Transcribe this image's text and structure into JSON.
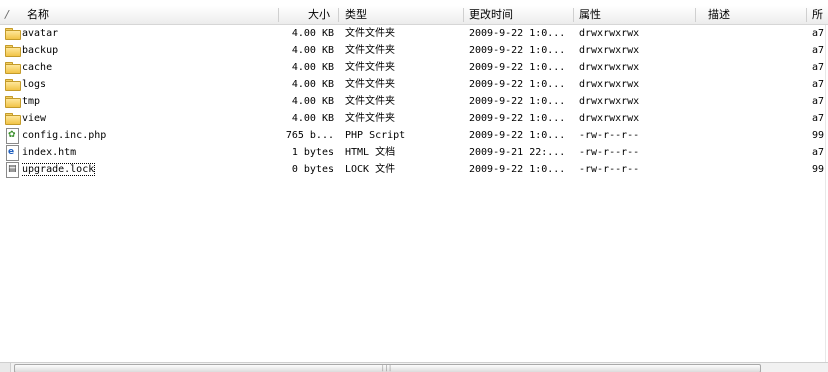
{
  "header": {
    "sort_indicator": "/",
    "columns": {
      "name": "名称",
      "size": "大小",
      "type": "类型",
      "modified": "更改时间",
      "permissions": "属性",
      "description": "描述",
      "owner": "所"
    }
  },
  "files": [
    {
      "name": "avatar",
      "size": "4.00 KB",
      "type": "文件文件夹",
      "modified": "2009-9-22 1:0...",
      "permissions": "drwxrwxrwx",
      "owner": "a7",
      "icon": "folder-icon"
    },
    {
      "name": "backup",
      "size": "4.00 KB",
      "type": "文件文件夹",
      "modified": "2009-9-22 1:0...",
      "permissions": "drwxrwxrwx",
      "owner": "a7",
      "icon": "folder-icon"
    },
    {
      "name": "cache",
      "size": "4.00 KB",
      "type": "文件文件夹",
      "modified": "2009-9-22 1:0...",
      "permissions": "drwxrwxrwx",
      "owner": "a7",
      "icon": "folder-icon"
    },
    {
      "name": "logs",
      "size": "4.00 KB",
      "type": "文件文件夹",
      "modified": "2009-9-22 1:0...",
      "permissions": "drwxrwxrwx",
      "owner": "a7",
      "icon": "folder-icon"
    },
    {
      "name": "tmp",
      "size": "4.00 KB",
      "type": "文件文件夹",
      "modified": "2009-9-22 1:0...",
      "permissions": "drwxrwxrwx",
      "owner": "a7",
      "icon": "folder-icon"
    },
    {
      "name": "view",
      "size": "4.00 KB",
      "type": "文件文件夹",
      "modified": "2009-9-22 1:0...",
      "permissions": "drwxrwxrwx",
      "owner": "a7",
      "icon": "folder-icon"
    },
    {
      "name": "config.inc.php",
      "size": "765 b...",
      "type": "PHP Script",
      "modified": "2009-9-22 1:0...",
      "permissions": "-rw-r--r--",
      "owner": "99",
      "icon": "php-file-icon"
    },
    {
      "name": "index.htm",
      "size": "1 bytes",
      "type": "HTML 文档",
      "modified": "2009-9-21 22:...",
      "permissions": "-rw-r--r--",
      "owner": "a7",
      "icon": "html-file-icon"
    },
    {
      "name": "upgrade.lock",
      "size": "0 bytes",
      "type": "LOCK 文件",
      "modified": "2009-9-22 1:0...",
      "permissions": "-rw-r--r--",
      "owner": "99",
      "icon": "lock-file-icon"
    }
  ],
  "colors": {
    "folder": "#f1c447",
    "php_icon": "#3a8f2a",
    "html_icon": "#1f5fbf"
  }
}
